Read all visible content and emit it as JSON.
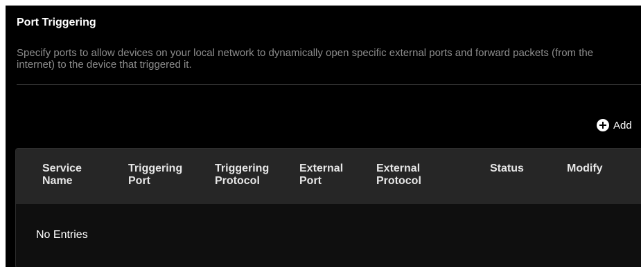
{
  "page": {
    "title": "Port Triggering",
    "description": "Specify ports to allow devices on your local network to dynamically open specific external ports and forward packets (from the internet) to the device that triggered it."
  },
  "toolbar": {
    "add_label": "Add"
  },
  "table": {
    "headers": [
      {
        "line1": "Service",
        "line2": "Name"
      },
      {
        "line1": "Triggering",
        "line2": "Port"
      },
      {
        "line1": "Triggering",
        "line2": "Protocol"
      },
      {
        "line1": "External",
        "line2": "Port"
      },
      {
        "line1": "External",
        "line2": "Protocol"
      },
      {
        "line1": "Status",
        "line2": ""
      },
      {
        "line1": "Modify",
        "line2": ""
      }
    ],
    "empty_text": "No Entries"
  },
  "icons": {
    "add": "plus-circle-icon"
  },
  "colors": {
    "background": "#000000",
    "header_bg": "#262626",
    "body_bg": "#0f0f0f",
    "description_text": "#8c8c8c",
    "text": "#ffffff"
  }
}
